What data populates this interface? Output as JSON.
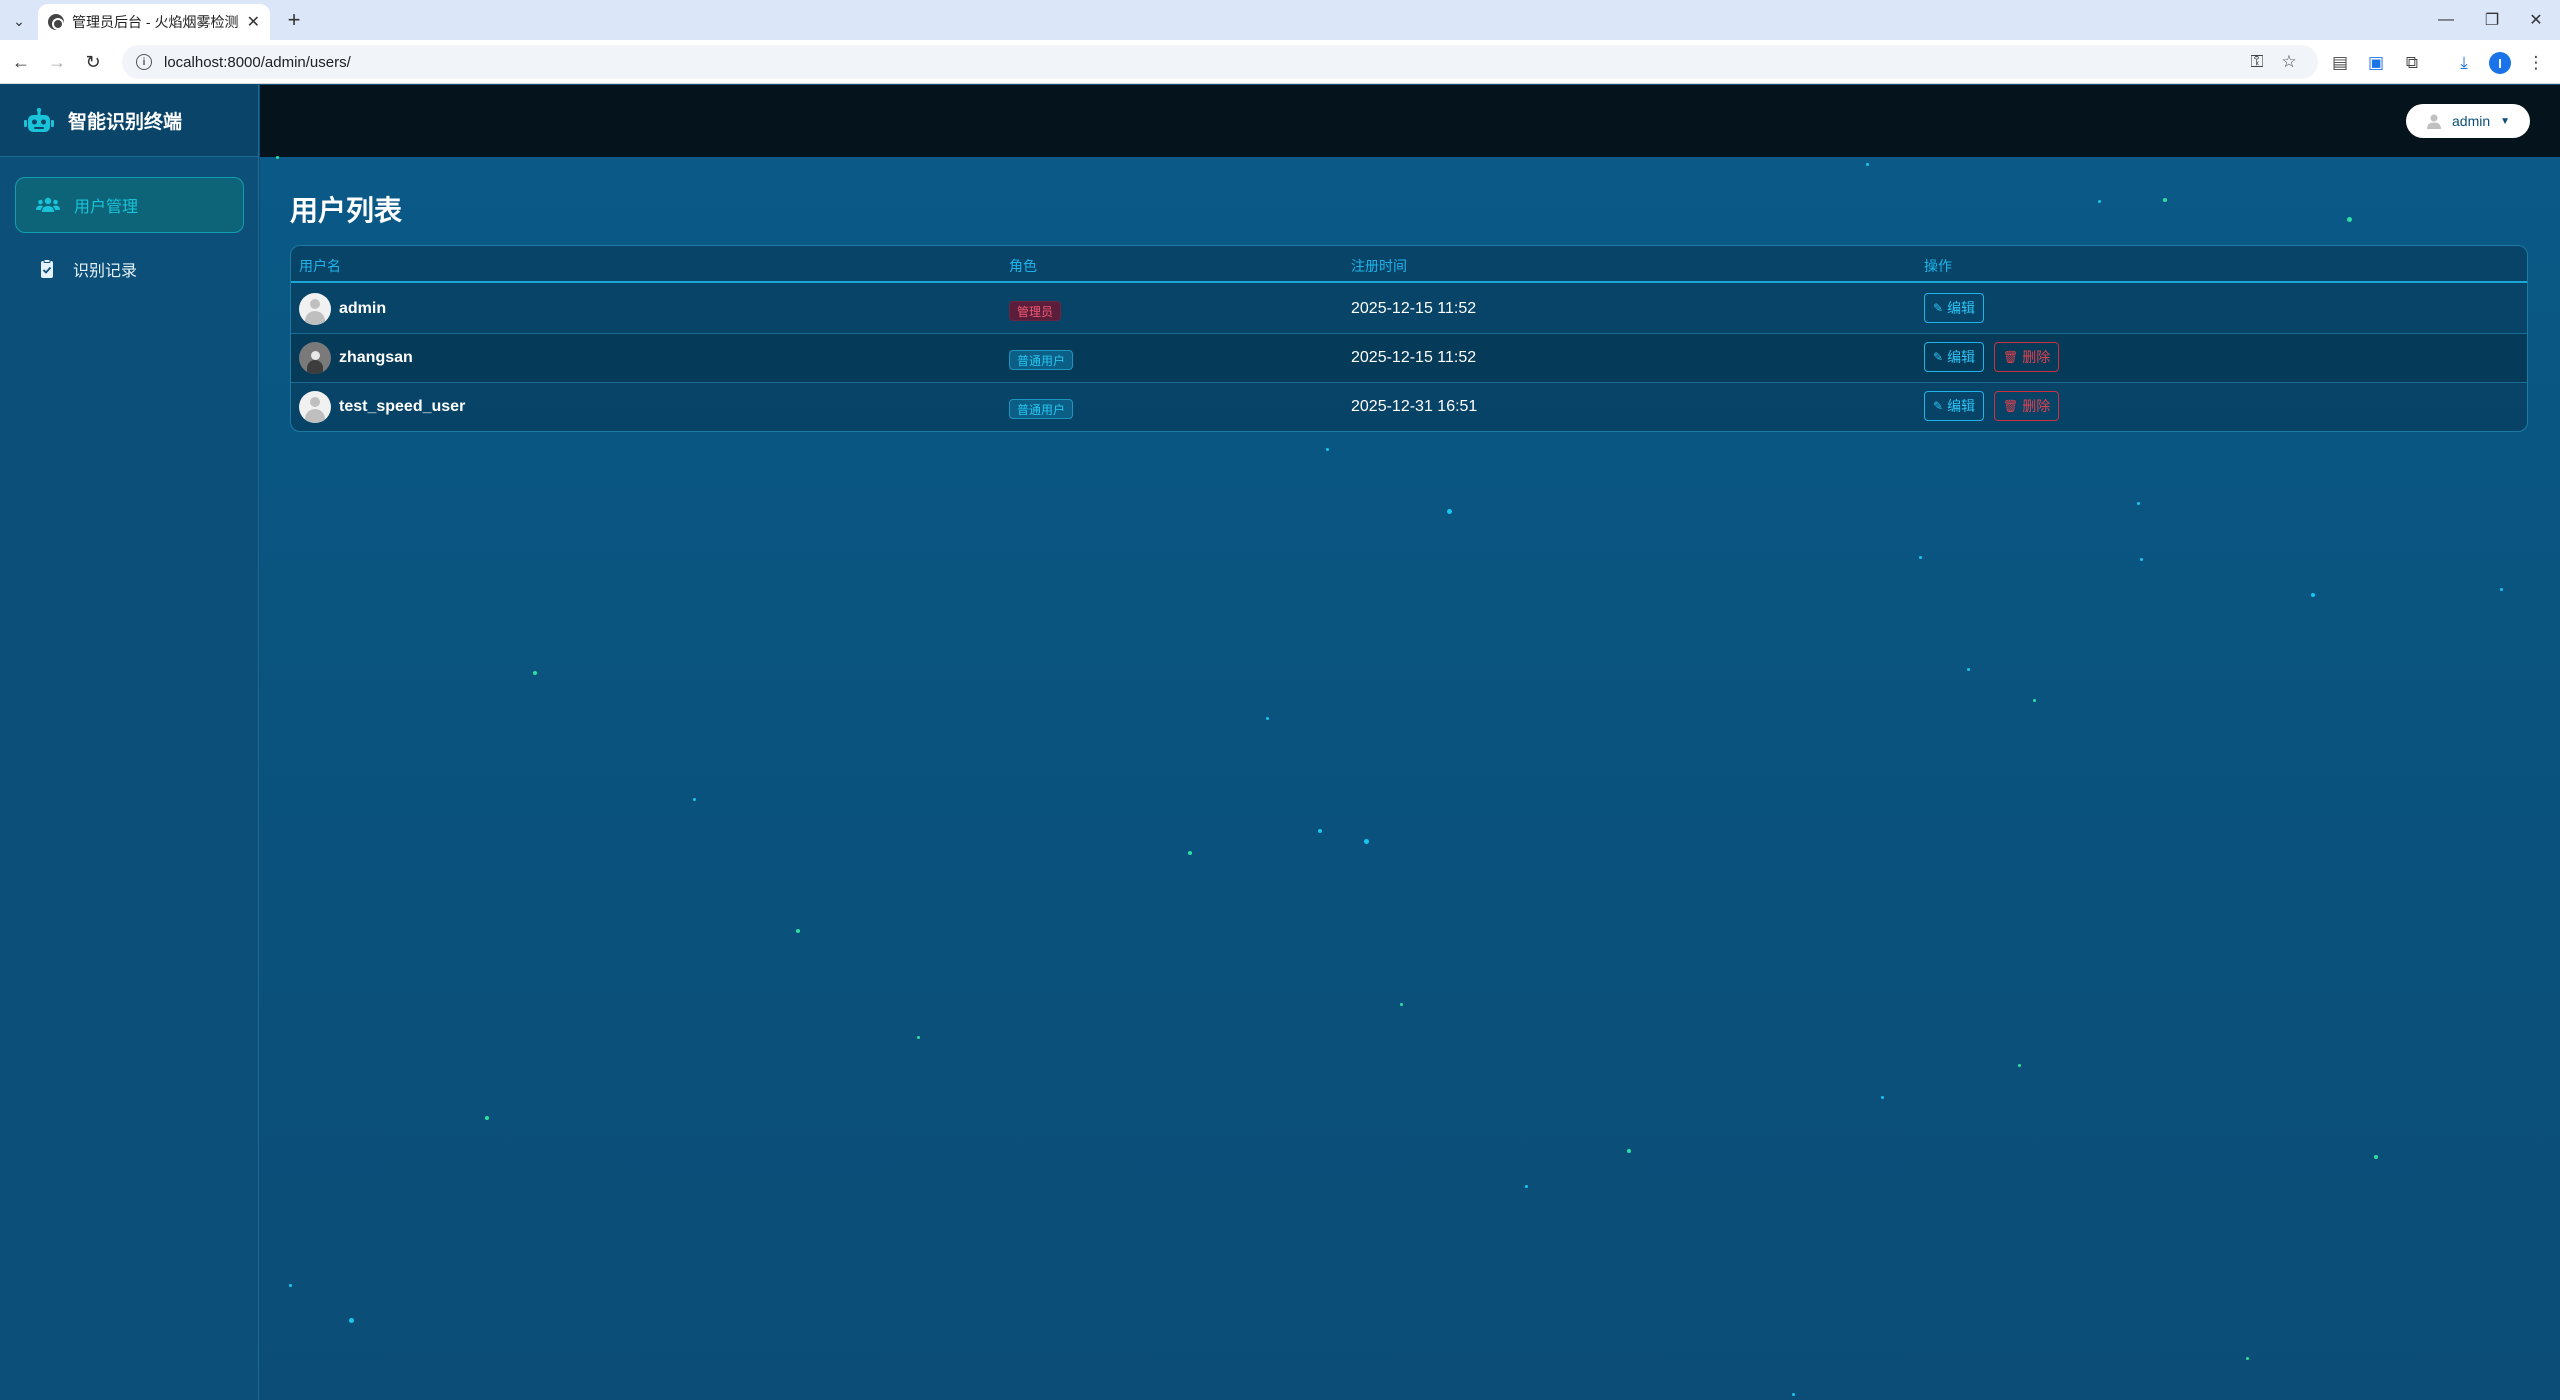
{
  "browser": {
    "tab_title": "管理员后台 - 火焰烟雾检测系统",
    "url": "localhost:8000/admin/users/",
    "profile_initial": "I"
  },
  "app": {
    "brand": "智能识别终端",
    "user_menu_label": "admin",
    "nav": [
      {
        "label": "用户管理",
        "active": true
      },
      {
        "label": "识别记录",
        "active": false
      }
    ]
  },
  "page": {
    "title": "用户列表",
    "columns": [
      "用户名",
      "角色",
      "注册时间",
      "操作"
    ],
    "rows": [
      {
        "username": "admin",
        "role": "管理员",
        "role_type": "admin",
        "registered": "2025-12-15 11:52",
        "actions": [
          "编辑"
        ]
      },
      {
        "username": "zhangsan",
        "role": "普通用户",
        "role_type": "user",
        "registered": "2025-12-15 11:52",
        "actions": [
          "编辑",
          "删除"
        ]
      },
      {
        "username": "test_speed_user",
        "role": "普通用户",
        "role_type": "user",
        "registered": "2025-12-31 16:51",
        "actions": [
          "编辑",
          "删除"
        ]
      }
    ]
  },
  "colors": {
    "sidebar_bg": "#0c4f78",
    "main_bg": "#0a5a87",
    "topbar_bg": "#05141c",
    "accent_cyan": "#1fb3ea",
    "danger_red": "#e0404e",
    "admin_badge": "#f05874",
    "particle_cyan": "#19c6f0",
    "particle_green": "#2de0a0"
  }
}
